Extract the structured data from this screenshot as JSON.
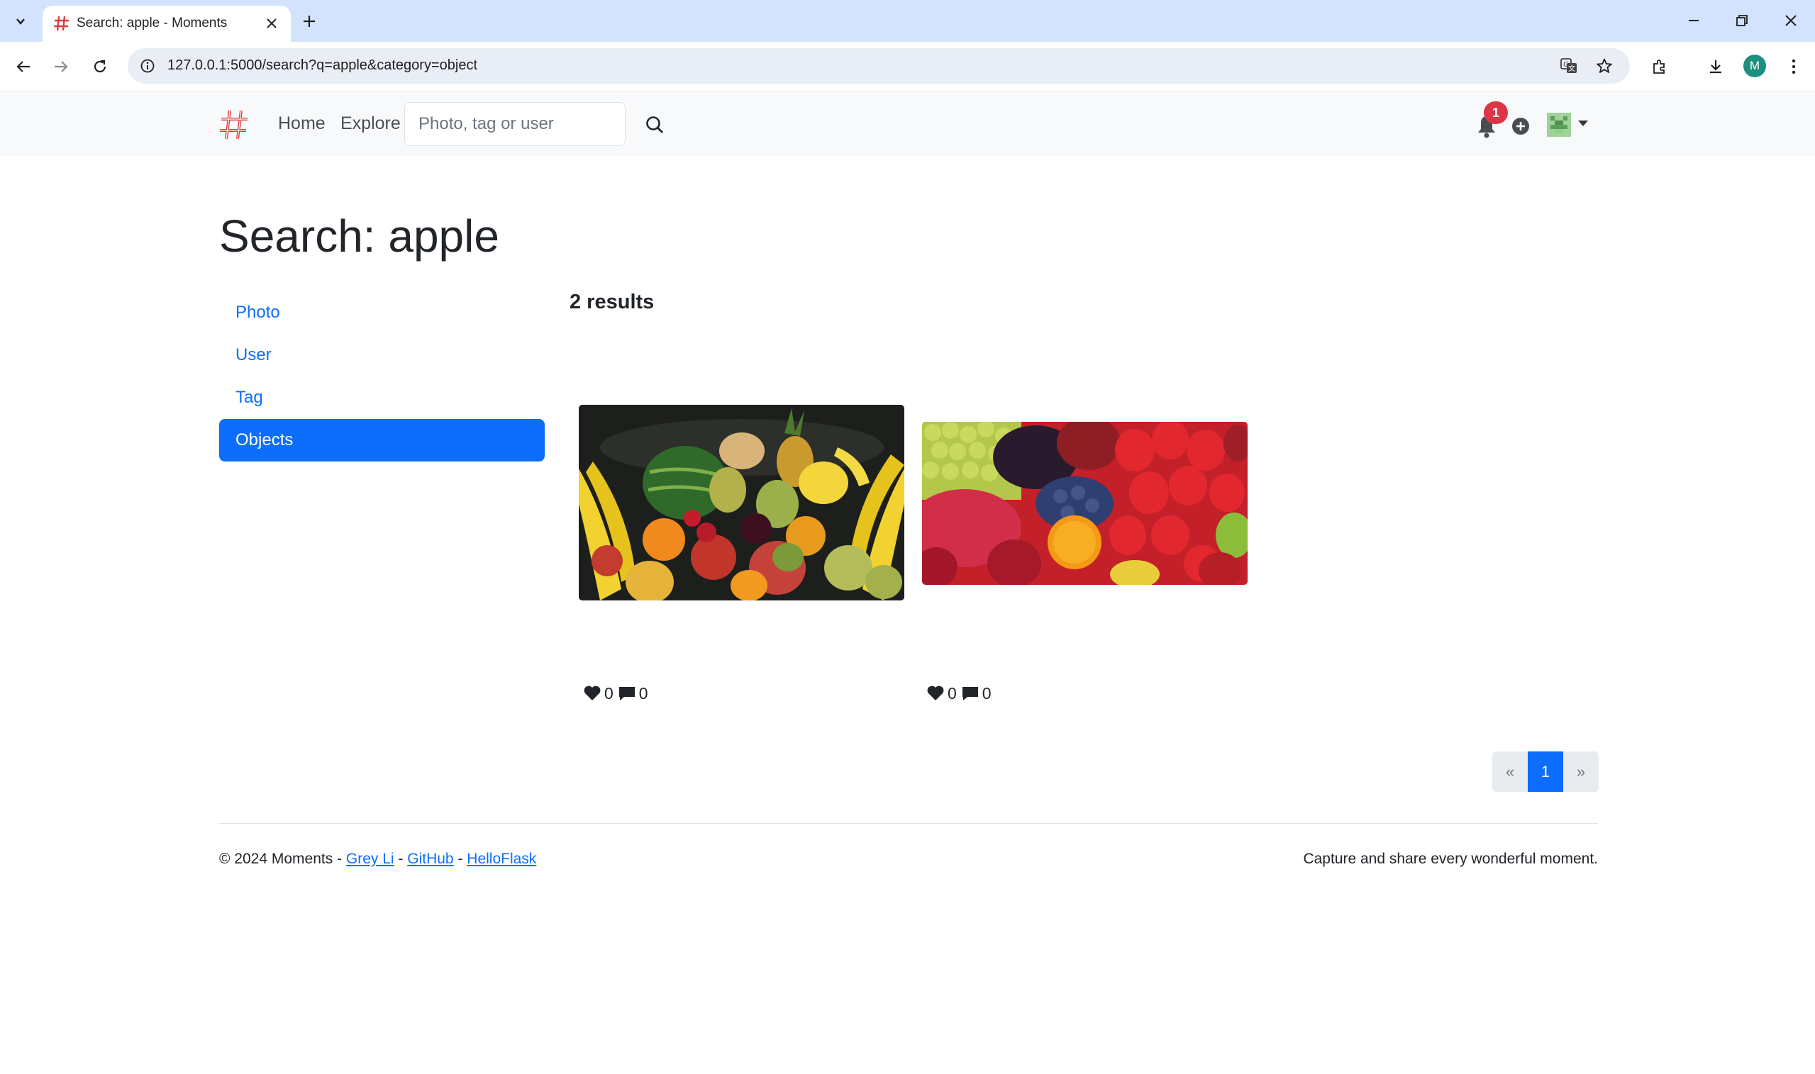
{
  "browser": {
    "tab_title": "Search: apple - Moments",
    "url": "127.0.0.1:5000/search?q=apple&category=object",
    "profile_initial": "M"
  },
  "nav": {
    "home": "Home",
    "explore": "Explore",
    "search_placeholder": "Photo, tag or user",
    "notification_count": "1"
  },
  "page": {
    "title": "Search: apple",
    "results_count": "2 results"
  },
  "sidebar": {
    "items": [
      {
        "label": "Photo",
        "active": false
      },
      {
        "label": "User",
        "active": false
      },
      {
        "label": "Tag",
        "active": false
      },
      {
        "label": "Objects",
        "active": true
      }
    ]
  },
  "photos": [
    {
      "likes": "0",
      "comments": "0"
    },
    {
      "likes": "0",
      "comments": "0"
    }
  ],
  "pagination": {
    "prev": "«",
    "current": "1",
    "next": "»"
  },
  "footer": {
    "copyright": "© 2024 Moments - ",
    "sep1": " - ",
    "sep2": " - ",
    "link_author": "Grey Li",
    "link_github": "GitHub",
    "link_helloflask": "HelloFlask",
    "tagline": "Capture and share every wonderful moment."
  },
  "colors": {
    "primary": "#0d6efd",
    "badge": "#dc3545",
    "tabstrip": "#d3e3fd"
  }
}
